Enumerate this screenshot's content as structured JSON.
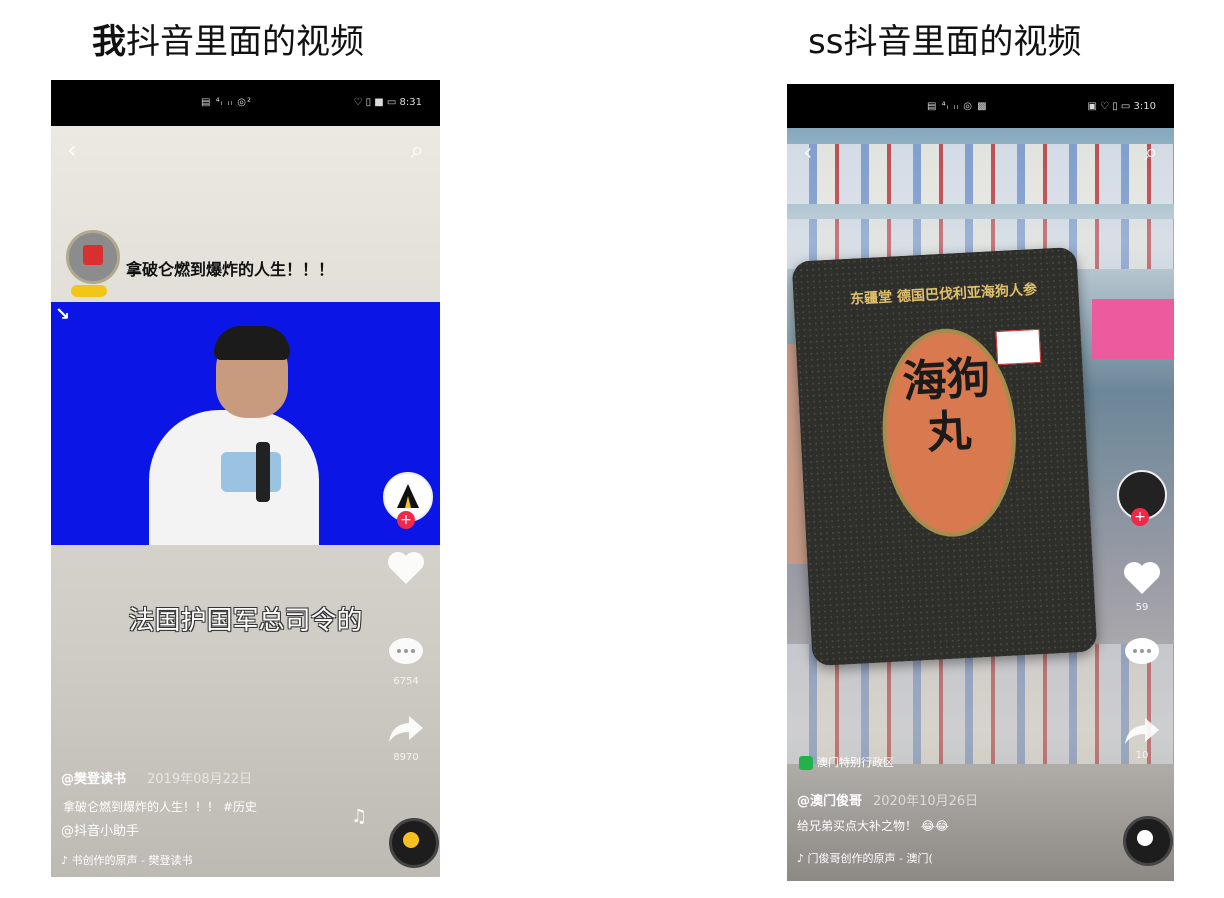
{
  "headings": {
    "left_bold": "我",
    "left_rest": "抖音里面的视频",
    "right": "ss抖音里面的视频"
  },
  "left_phone": {
    "status_left": "▤ ⁴ᵢ ᵢₗ ◎²",
    "status_right": "♡ ▯ ■ ▭ 8:31",
    "top_title": "拿破仑燃到爆炸的人生！！！",
    "caption": "法国护国军总司令的",
    "counts": {
      "comment": "6754",
      "share": "8970"
    },
    "author": "@樊登读书",
    "date": "2019年08月22日",
    "description": "拿破仑燃到爆炸的人生！！！ #历史",
    "mention": "@抖音小助手",
    "music": "♪ 书创作的原声 - 樊登读书",
    "icons": {
      "back": "back-icon",
      "search": "search-icon",
      "like": "heart-icon",
      "comment": "comment-icon",
      "share": "share-icon",
      "music_note": "music-note-icon"
    }
  },
  "right_phone": {
    "status_left": "▤ ⁴ᵢ ᵢₗ ◎ ▩",
    "status_right": "▣ ♡ ▯ ▭ 3:10",
    "package_top": "东疆堂  德国巴伐利亚海狗人参",
    "package_name": "海狗丸",
    "counts": {
      "like": "59",
      "share": "10"
    },
    "location": "澳门特别行政区",
    "author": "@澳门俊哥",
    "date": "2020年10月26日",
    "description": "给兄弟买点大补之物！ 😂😂",
    "music": "♪ 门俊哥创作的原声 - 澳门(",
    "icons": {
      "back": "back-icon",
      "search": "search-icon",
      "like": "heart-icon",
      "comment": "comment-icon",
      "share": "share-icon",
      "location": "location-pin-icon"
    }
  }
}
